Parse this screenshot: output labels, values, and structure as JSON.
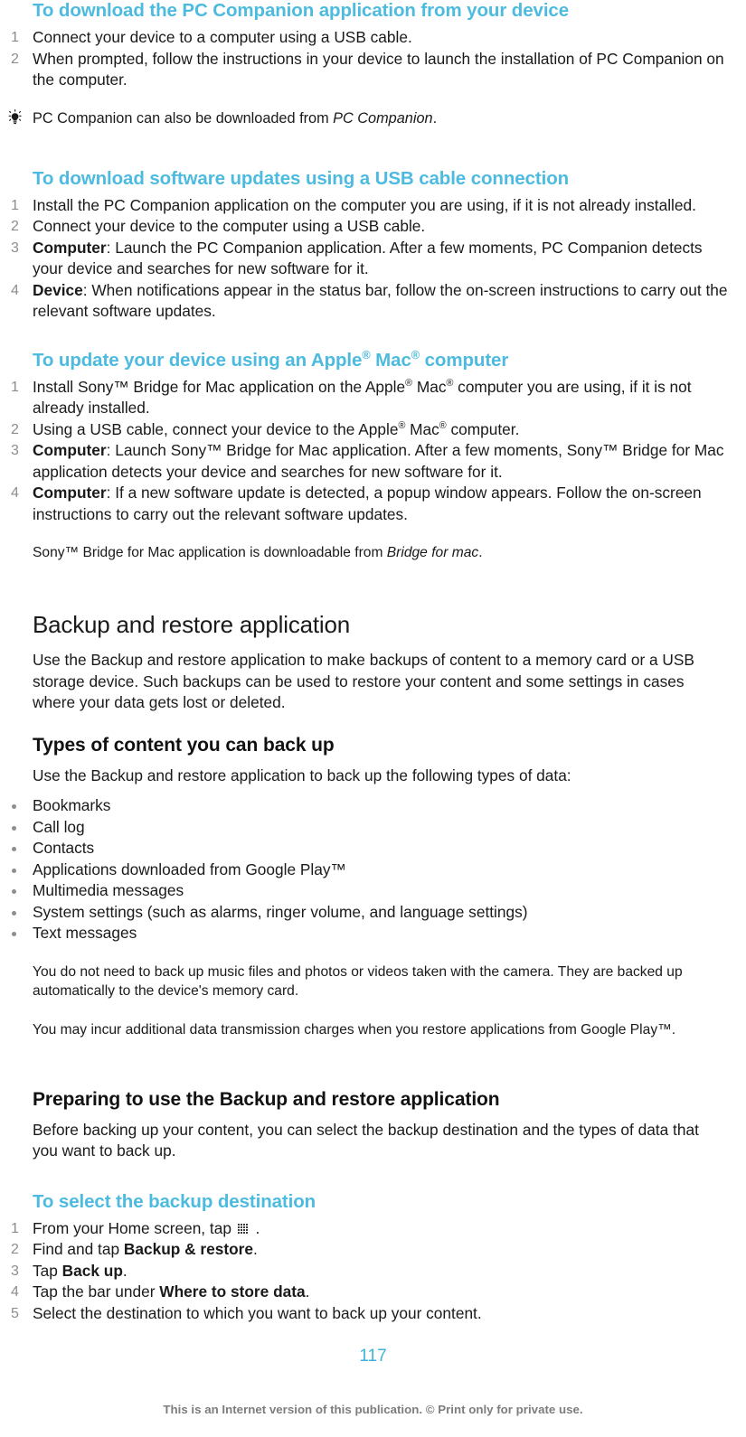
{
  "document": {
    "page_number": "117",
    "footer_text": "This is an Internet version of this publication. © Print only for private use.",
    "accent_color": "#4cbbdf",
    "page_number_color": "#3fb3db"
  },
  "sections": {
    "pc_companion_download": {
      "heading": "To download the PC Companion application from your device",
      "steps": [
        {
          "num": "1",
          "text": "Connect your device to a computer using a USB cable."
        },
        {
          "num": "2",
          "text": "When prompted, follow the instructions in your device to launch the installation of PC Companion on the computer."
        }
      ],
      "tip": {
        "icon": "lightbulb-tip-icon",
        "text_before": "PC Companion can also be downloaded from ",
        "link_text": "PC Companion",
        "text_after": "."
      }
    },
    "usb_cable_updates": {
      "heading": "To download software updates using a USB cable connection",
      "steps": [
        {
          "num": "1",
          "lead": "",
          "text": "Install the PC Companion application on the computer you are using, if it is not already installed."
        },
        {
          "num": "2",
          "lead": "",
          "text": "Connect your device to the computer using a USB cable."
        },
        {
          "num": "3",
          "lead": "Computer",
          "text": ": Launch the PC Companion application. After a few moments, PC Companion detects your device and searches for new software for it."
        },
        {
          "num": "4",
          "lead": "Device",
          "text": ": When notifications appear in the status bar, follow the on-screen instructions to carry out the relevant software updates."
        }
      ]
    },
    "mac_updates": {
      "heading_parts": {
        "a": "To update your device using an Apple",
        "sup1": "®",
        "b": " Mac",
        "sup2": "®",
        "c": " computer"
      },
      "heading_plain": "To update your device using an Apple® Mac® computer",
      "steps": [
        {
          "num": "1",
          "lead": "",
          "text_a": "Install Sony™ Bridge for Mac application on the Apple",
          "sup1": "®",
          "text_b": " Mac",
          "sup2": "®",
          "text_c": " computer you are using, if it is not already installed."
        },
        {
          "num": "2",
          "lead": "",
          "text_a": "Using a USB cable, connect your device to the Apple",
          "sup1": "®",
          "text_b": " Mac",
          "sup2": "®",
          "text_c": " computer."
        },
        {
          "num": "3",
          "lead": "Computer",
          "text_a": ": Launch Sony™ Bridge for Mac application. After a few moments, Sony™ Bridge for Mac application detects your device and searches for new software for it.",
          "sup1": "",
          "text_b": "",
          "sup2": "",
          "text_c": ""
        },
        {
          "num": "4",
          "lead": "Computer",
          "text_a": ": If a new software update is detected, a popup window appears. Follow the on-screen instructions to carry out the relevant software updates.",
          "sup1": "",
          "text_b": "",
          "sup2": "",
          "text_c": ""
        }
      ],
      "note": {
        "icon": "exclamation-note-icon",
        "text_before": "Sony™ Bridge for Mac application is downloadable from ",
        "link_text": "Bridge for mac",
        "text_after": "."
      }
    },
    "backup_restore": {
      "heading": "Backup and restore application",
      "intro": "Use the Backup and restore application to make backups of content to a memory card or a USB storage device. Such backups can be used to restore your content and some settings in cases where your data gets lost or deleted."
    },
    "types_of_content": {
      "heading": "Types of content you can back up",
      "intro": "Use the Backup and restore application to back up the following types of data:",
      "bullets": [
        "Bookmarks",
        "Call log",
        "Contacts",
        "Applications downloaded from Google Play™",
        "Multimedia messages",
        "System settings (such as alarms, ringer volume, and language settings)",
        "Text messages"
      ],
      "note1": {
        "icon": "exclamation-note-icon",
        "text": "You do not need to back up music files and photos or videos taken with the camera. They are backed up automatically to the device's memory card."
      },
      "note2": {
        "icon": "exclamation-note-icon",
        "text": "You may incur additional data transmission charges when you restore applications from Google Play™."
      }
    },
    "preparing": {
      "heading": "Preparing to use the Backup and restore application",
      "intro": "Before backing up your content, you can select the backup destination and the types of data that you want to back up."
    },
    "select_destination": {
      "heading": "To select the backup destination",
      "steps": [
        {
          "num": "1",
          "text_a": "From your Home screen, tap ",
          "icon": "app-grid-icon",
          "text_b": " .",
          "lead": "",
          "lead_tail": ""
        },
        {
          "num": "2",
          "text_a": "Find and tap ",
          "icon": "",
          "text_b": "",
          "lead": "Backup & restore",
          "lead_tail": "."
        },
        {
          "num": "3",
          "text_a": "Tap ",
          "icon": "",
          "text_b": "",
          "lead": "Back up",
          "lead_tail": "."
        },
        {
          "num": "4",
          "text_a": "Tap the bar under ",
          "icon": "",
          "text_b": "",
          "lead": "Where to store data",
          "lead_tail": "."
        },
        {
          "num": "5",
          "text_a": "Select the destination to which you want to back up your content.",
          "icon": "",
          "text_b": "",
          "lead": "",
          "lead_tail": ""
        }
      ]
    }
  }
}
